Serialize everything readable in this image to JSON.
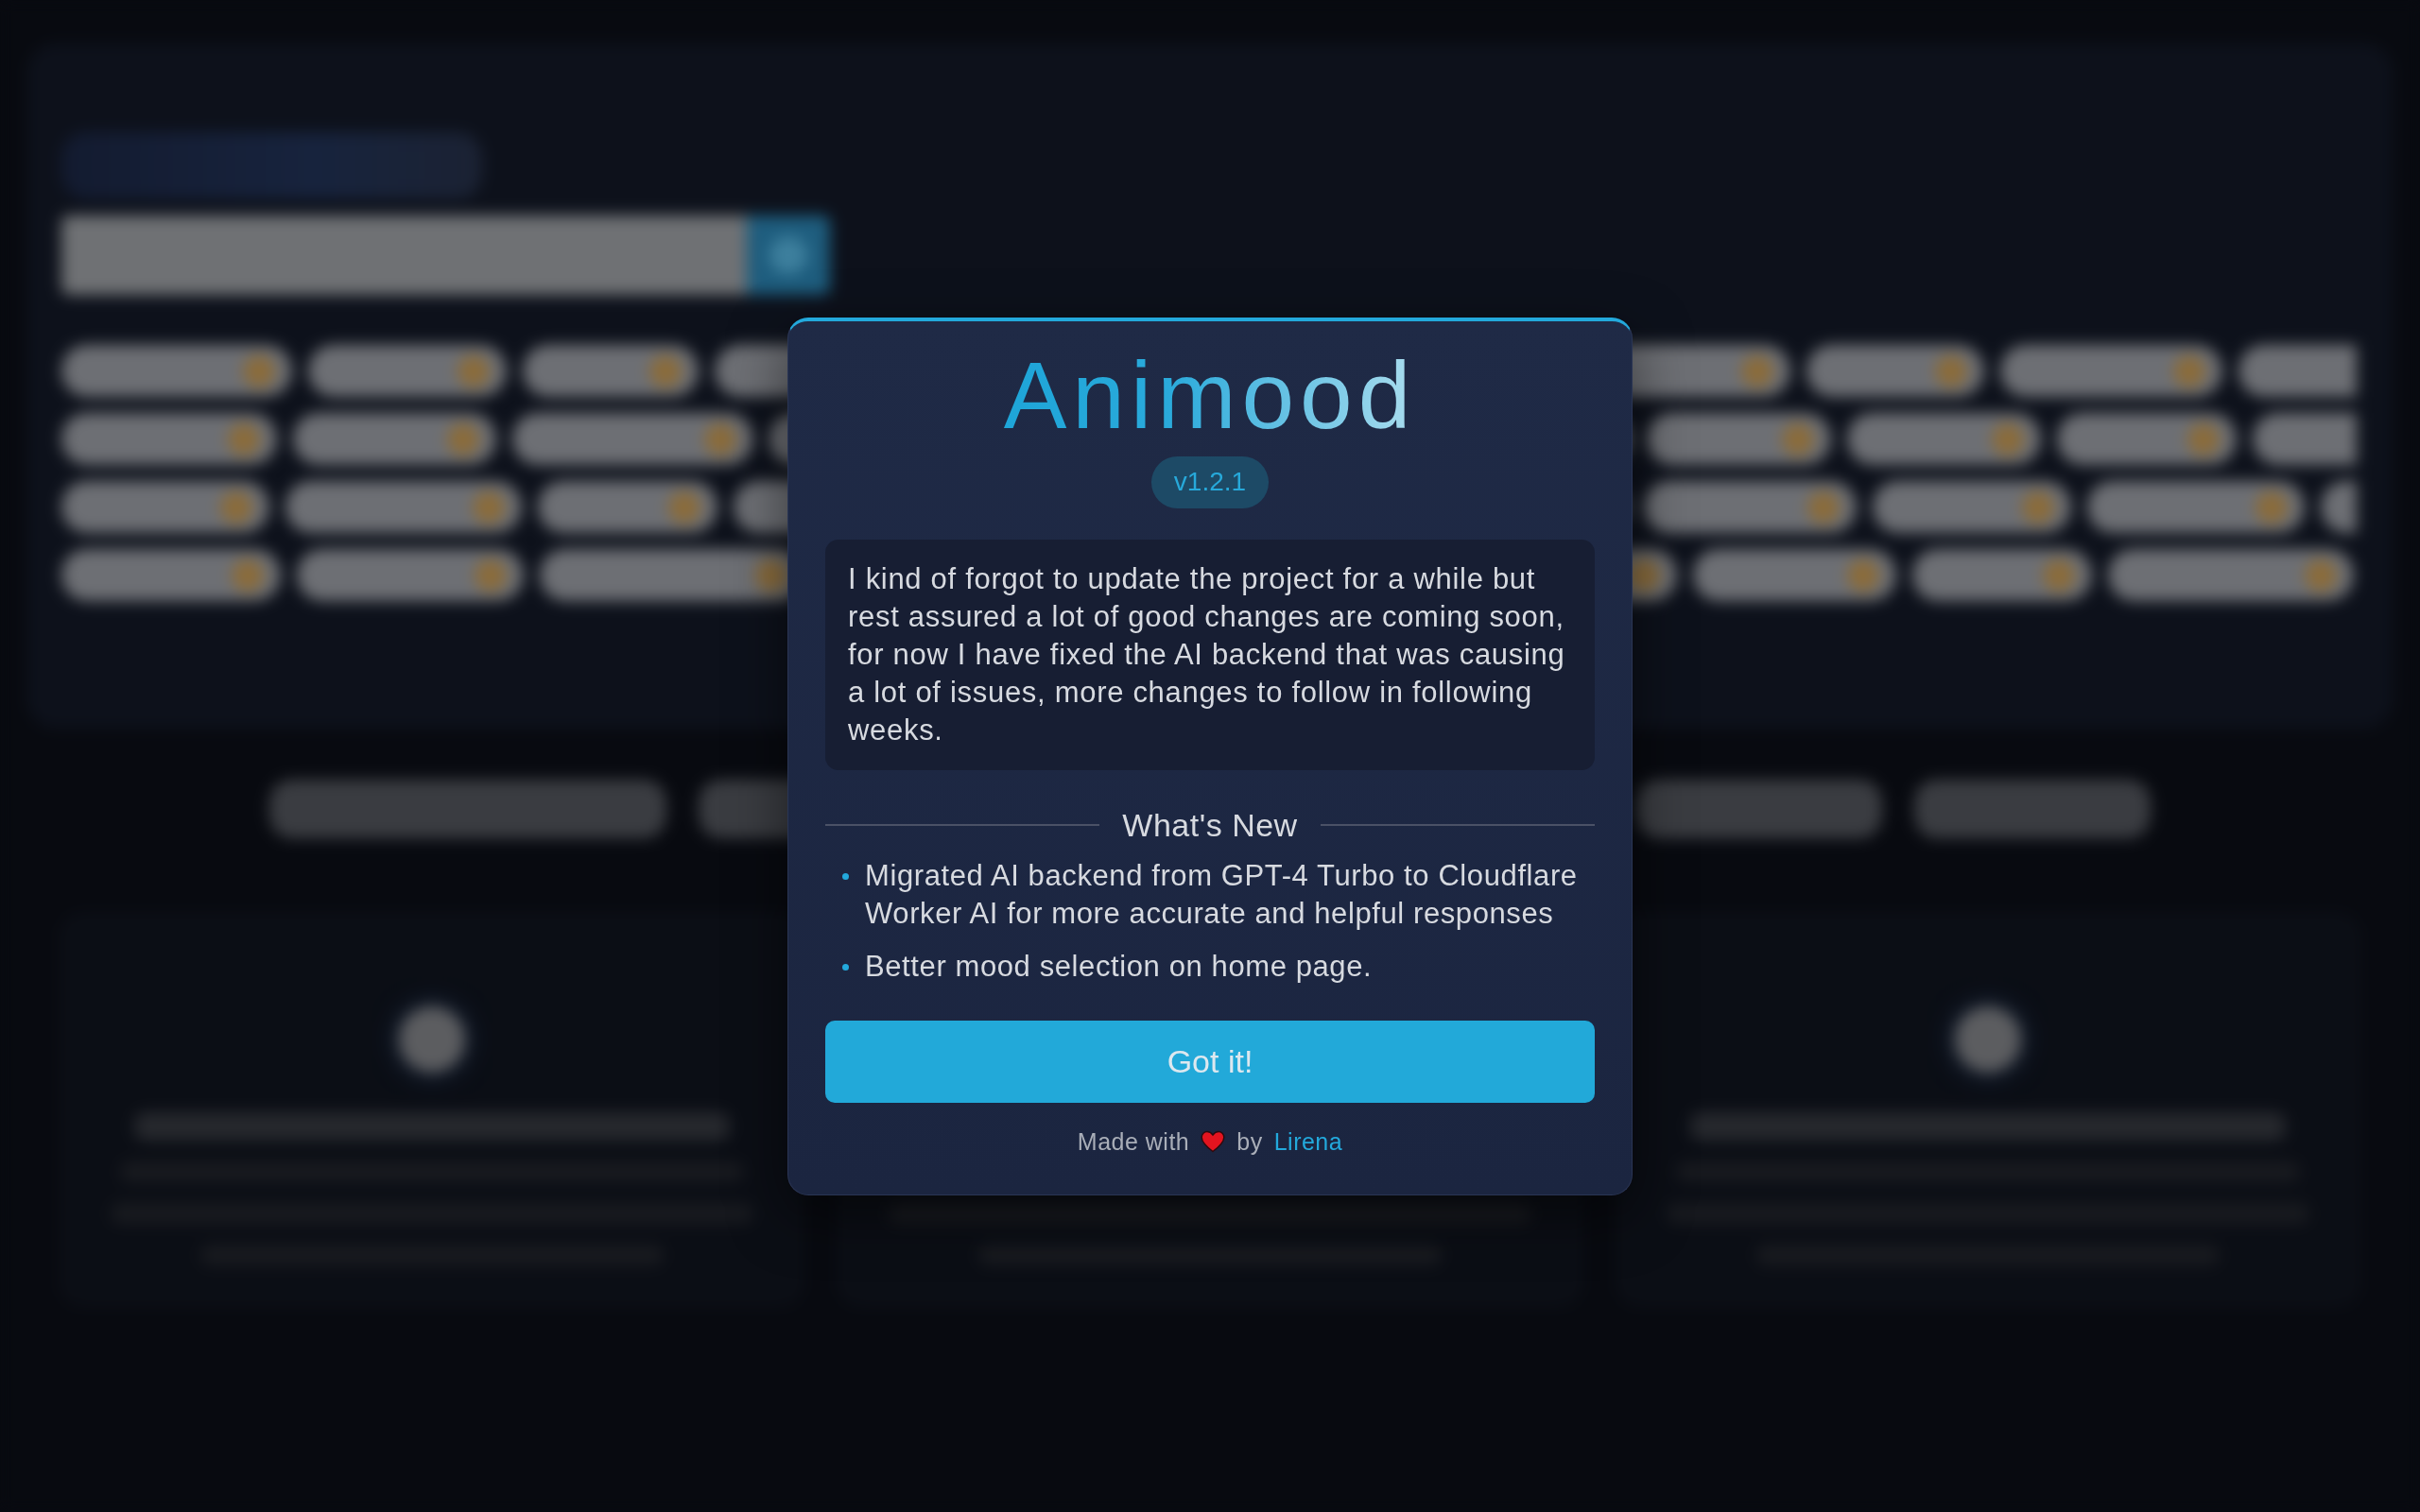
{
  "dialog": {
    "title": "Animood",
    "version": "v1.2.1",
    "message": "I kind of forgot to update the project for a while but rest assured a lot of good changes are coming soon, for now I have fixed the AI backend that was causing a lot of issues, more changes to follow in following weeks.",
    "section_title": "What's New",
    "changes": [
      "Migrated AI backend from GPT-4 Turbo to Cloudflare Worker AI for more accurate and helpful responses",
      "Better mood selection on home page."
    ],
    "button": "Got it!",
    "footer": {
      "prefix": "Made with",
      "joiner": "by",
      "author": "Lirena"
    }
  }
}
